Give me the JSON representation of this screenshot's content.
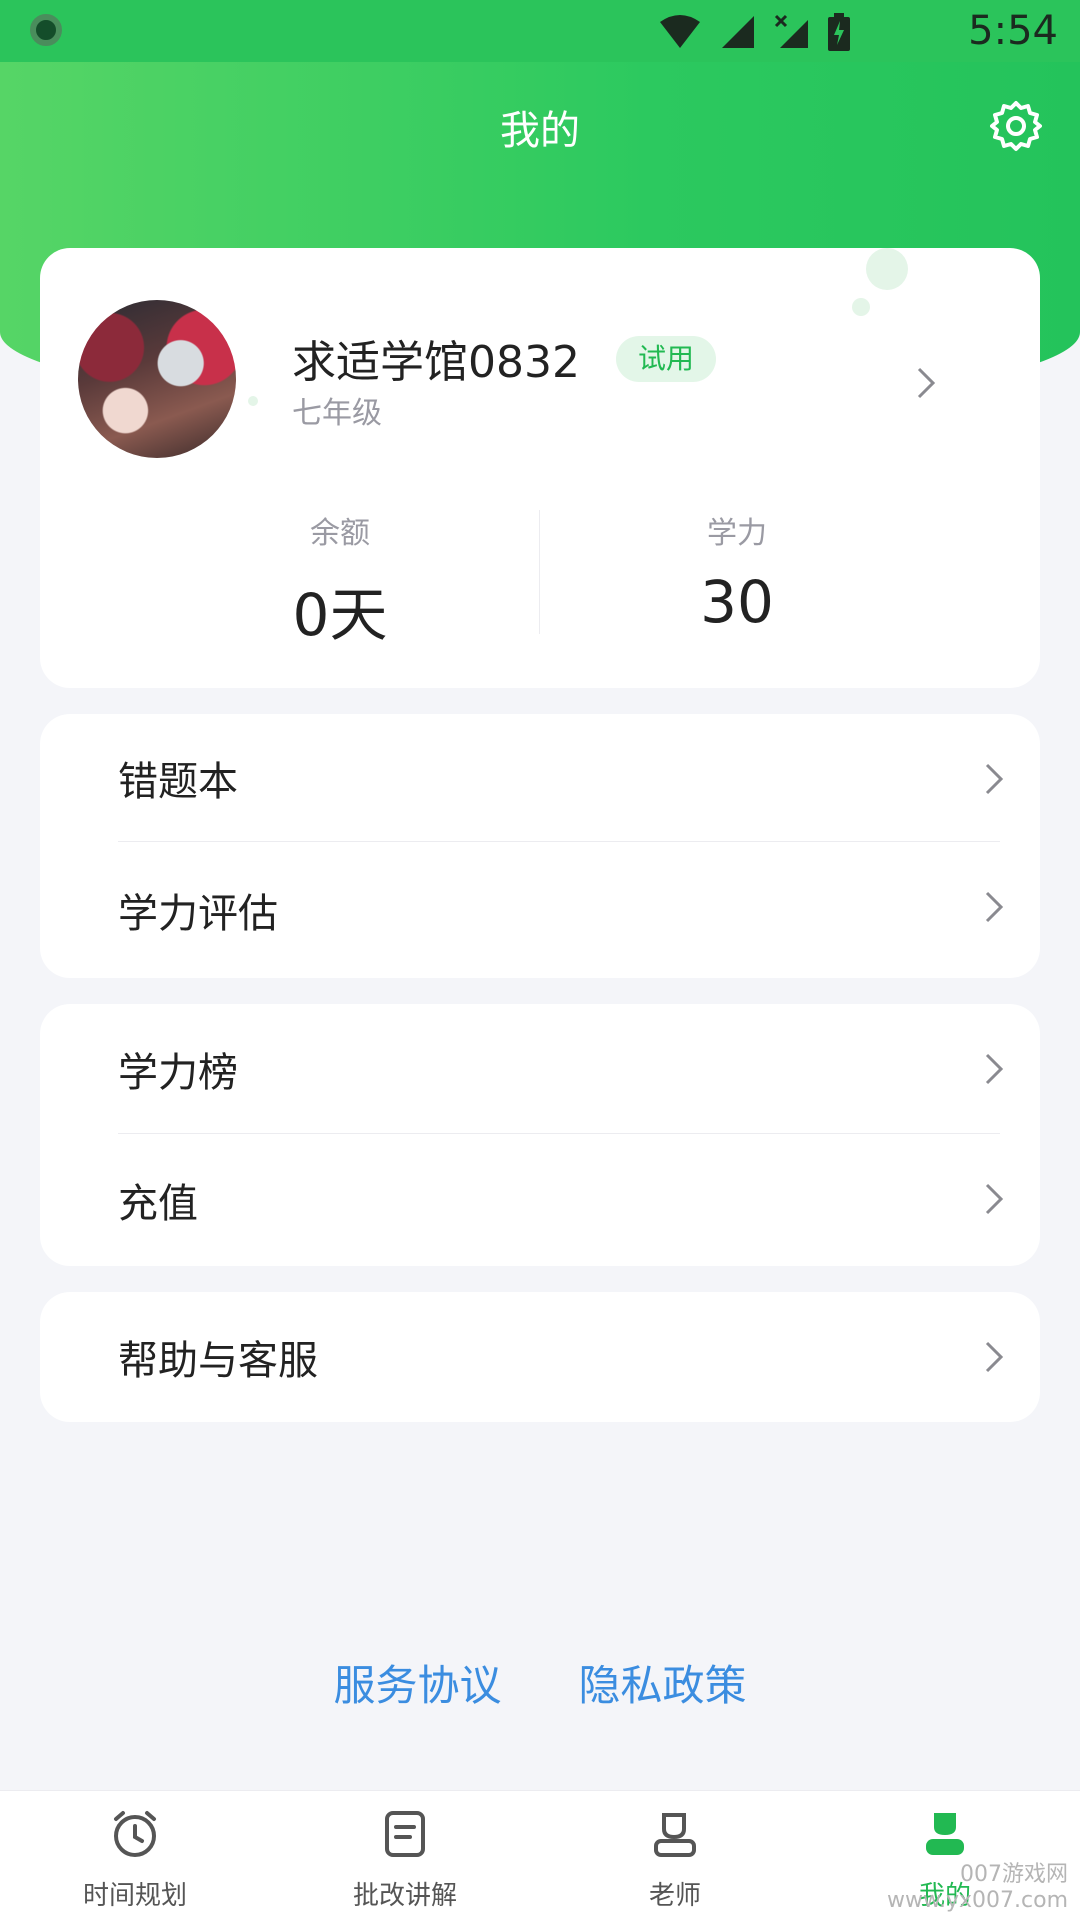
{
  "status_bar": {
    "time": "5:54"
  },
  "header": {
    "title": "我的"
  },
  "profile": {
    "name": "求适学馆0832",
    "badge": "试用",
    "grade": "七年级",
    "balance_label": "余额",
    "balance_value": "0天",
    "score_label": "学力",
    "score_value": "30"
  },
  "menu_groups": [
    {
      "items": [
        {
          "label": "错题本"
        },
        {
          "label": "学力评估"
        }
      ]
    },
    {
      "items": [
        {
          "label": "学力榜"
        },
        {
          "label": "充值"
        }
      ]
    },
    {
      "items": [
        {
          "label": "帮助与客服"
        }
      ]
    }
  ],
  "links": {
    "service_agreement": "服务协议",
    "privacy_policy": "隐私政策"
  },
  "tabs": [
    {
      "label": "时间规划",
      "icon": "alarm-clock-icon"
    },
    {
      "label": "批改讲解",
      "icon": "document-icon"
    },
    {
      "label": "老师",
      "icon": "teacher-icon"
    },
    {
      "label": "我的",
      "icon": "profile-icon",
      "active": true
    }
  ],
  "watermark": {
    "line1": "007游戏网",
    "line2": "www.yx007.com"
  },
  "colors": {
    "accent": "#2bc45b",
    "link": "#3b8de0",
    "badge_text": "#22b952"
  }
}
